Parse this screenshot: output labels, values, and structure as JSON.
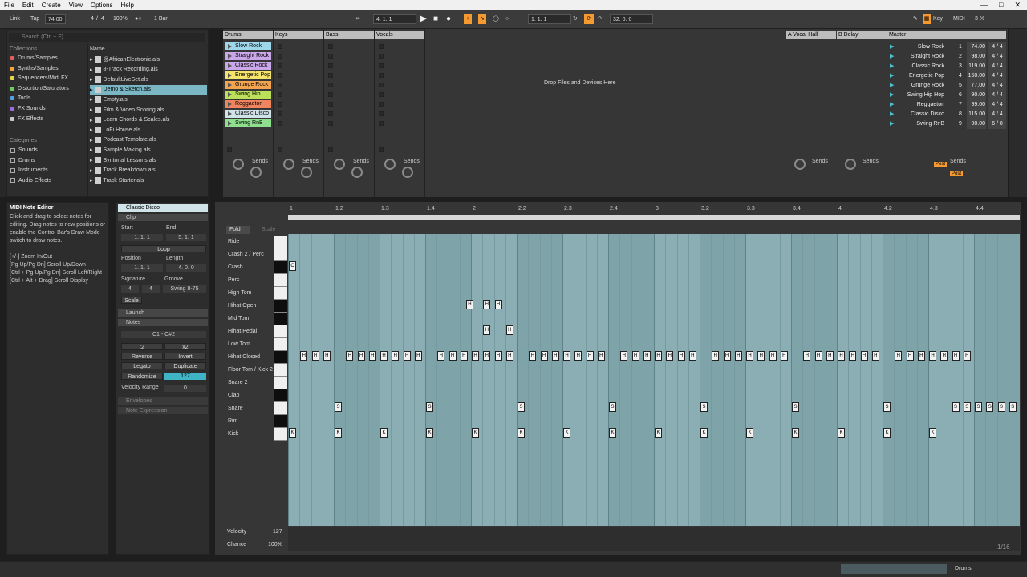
{
  "menu": [
    "File",
    "Edit",
    "Create",
    "View",
    "Options",
    "Help"
  ],
  "transport": {
    "link": "Link",
    "tap": "Tap",
    "tempo": "74.00",
    "sig_num": "4",
    "sig_den": "4",
    "zoom": "100%",
    "quant": "1 Bar",
    "pos": "4.   1.   1",
    "loop_start": "1.   1.   1",
    "loop_len": "32.   0.   0",
    "key": "Key",
    "midi": "MIDI",
    "cpu": "3 %"
  },
  "browser": {
    "search_placeholder": "Search (Ctrl + F)",
    "collections_title": "Collections",
    "collections": [
      {
        "label": "Drums/Samples",
        "color": "#e35d5d"
      },
      {
        "label": "Synths/Samples",
        "color": "#f5a442"
      },
      {
        "label": "Sequencers/Midi FX",
        "color": "#e7d54b"
      },
      {
        "label": "Distortion/Saturators",
        "color": "#6cce5a"
      },
      {
        "label": "Tools",
        "color": "#4ea3e0"
      },
      {
        "label": "FX Sounds",
        "color": "#9b6de0"
      },
      {
        "label": "FX Effects",
        "color": "#c9c9c9"
      }
    ],
    "categories_title": "Categories",
    "categories": [
      "Sounds",
      "Drums",
      "Instruments",
      "Audio Effects"
    ],
    "name_header": "Name",
    "files": [
      "@AfricanElectronic.als",
      "8-Track Recording.als",
      "DefaultLiveSet.als",
      "Demo & Sketch.als",
      "Empty.als",
      "Film & Video Scoring.als",
      "Learn Chords & Scales.als",
      "LoFi House.als",
      "Podcast Template.als",
      "Sample Making.als",
      "Syntorial Lessons.als",
      "Track Breakdown.als",
      "Track Starter.als"
    ],
    "selected_file_index": 3
  },
  "session": {
    "tracks": [
      {
        "name": "Drums",
        "color": "#bdbdbd"
      },
      {
        "name": "Keys",
        "color": "#bdbdbd"
      },
      {
        "name": "Bass",
        "color": "#bdbdbd"
      },
      {
        "name": "Vocals",
        "color": "#bdbdbd"
      }
    ],
    "clips": [
      {
        "label": "Slow Rock",
        "color": "#9fd7ea"
      },
      {
        "label": "Straight Rock",
        "color": "#c9a7e9"
      },
      {
        "label": "Classic Rock",
        "color": "#c9a7e9"
      },
      {
        "label": "Energetic Pop",
        "color": "#f4e46b"
      },
      {
        "label": "Grunge Rock",
        "color": "#f4a44e"
      },
      {
        "label": "Swing Hip Hop",
        "color": "#bde05b"
      },
      {
        "label": "Reggaeton",
        "color": "#f0845e"
      },
      {
        "label": "Classic Disco",
        "color": "#cfe3e8"
      },
      {
        "label": "Swing RnB",
        "color": "#8ee08e"
      }
    ],
    "drop_text": "Drop Files and Devices Here",
    "returns": [
      {
        "name": "A Vocal Hall"
      },
      {
        "name": "B Delay"
      }
    ],
    "master_name": "Master",
    "sends_label": "Sends",
    "post_label": "Post",
    "scenes": [
      {
        "name": "Slow Rock",
        "num": "1",
        "tempo": "74.00",
        "sig": "4 / 4"
      },
      {
        "name": "Straight Rock",
        "num": "2",
        "tempo": "98.00",
        "sig": "4 / 4"
      },
      {
        "name": "Classic Rock",
        "num": "3",
        "tempo": "119.00",
        "sig": "4 / 4"
      },
      {
        "name": "Energetic Pop",
        "num": "4",
        "tempo": "160.00",
        "sig": "4 / 4"
      },
      {
        "name": "Grunge Rock",
        "num": "5",
        "tempo": "77.00",
        "sig": "4 / 4"
      },
      {
        "name": "Swing Hip Hop",
        "num": "6",
        "tempo": "90.00",
        "sig": "4 / 4"
      },
      {
        "name": "Reggaeton",
        "num": "7",
        "tempo": "99.00",
        "sig": "4 / 4"
      },
      {
        "name": "Classic Disco",
        "num": "8",
        "tempo": "115.00",
        "sig": "4 / 4"
      },
      {
        "name": "Swing RnB",
        "num": "9",
        "tempo": "90.00",
        "sig": "6 / 8"
      }
    ]
  },
  "info": {
    "title": "MIDI Note Editor",
    "body": "Click and drag to select notes for editing. Drag notes to new positions or enable the Control Bar's Draw Mode switch to draw notes.",
    "keys": [
      "[+/-] Zoom In/Out",
      "[Pg Up/Pg Dn] Scroll Up/Down",
      "[Ctrl + Pg Up/Pg Dn] Scroll Left/Right",
      "[Ctrl + Alt + Drag] Scroll Display"
    ]
  },
  "clip": {
    "name": "Classic Disco",
    "clip_section": "Clip",
    "start": "Start",
    "end": "End",
    "start_val": "1.   1.   1",
    "end_val": "5.   1.   1",
    "loop": "Loop",
    "position": "Position",
    "length": "Length",
    "pos_val": "1.   1.   1",
    "len_val": "4.   0.   0",
    "signature": "Signature",
    "groove": "Groove",
    "sig_num": "4",
    "sig_den": "4",
    "groove_val": "Swing 8-75",
    "scale": "Scale",
    "launch": "Launch",
    "notes": "Notes",
    "range": "C1 - C#2",
    "x2a": ":2",
    "x2b": "x2",
    "reverse": "Reverse",
    "invert": "Invert",
    "legato": "Legato",
    "duplicate": "Duplicate",
    "randomize": "Randomize",
    "rand_val": "127",
    "vel_range": "Velocity Range",
    "vel_val": "0",
    "envelopes": "Envelopes",
    "note_expr": "Note Expression",
    "set": "Set"
  },
  "editor": {
    "fold": "Fold",
    "scale": "Scale",
    "ruler": [
      "1",
      "1.2",
      "1.3",
      "1.4",
      "2",
      "2.2",
      "2.3",
      "2.4",
      "3",
      "3.2",
      "3.3",
      "3.4",
      "4",
      "4.2",
      "4.3",
      "4.4"
    ],
    "lanes": [
      "Ride",
      "Crash 2 / Perc",
      "Crash",
      "Perc",
      "High Tom",
      "Hihat Open",
      "Mid Tom",
      "Hihat Pedal",
      "Low Tom",
      "Hihat Closed",
      "Floor Tom / Kick 2",
      "Snare 2",
      "Clap",
      "Snare",
      "Rim",
      "Kick"
    ],
    "velocity": "Velocity",
    "vel_val": "127",
    "chance": "Chance",
    "chance_val": "100%",
    "grid": "1/16"
  },
  "status": {
    "track": "Drums"
  }
}
